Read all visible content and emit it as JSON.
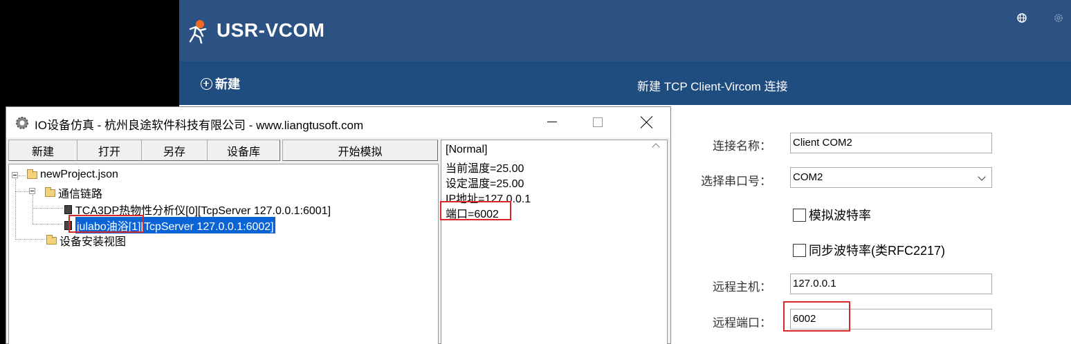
{
  "vcom": {
    "app_title": "USR-VCOM",
    "new_button": "新建",
    "connection_title": "新建 TCP Client-Vircom 连接",
    "form": {
      "name_label": "连接名称：",
      "name_value": "Client COM2",
      "port_label": "选择串口号：",
      "port_value": "COM2",
      "sim_baud_label": "模拟波特率",
      "sync_baud_label": "同步波特率(类RFC2217)",
      "remote_host_label": "远程主机：",
      "remote_host_value": "127.0.0.1",
      "remote_port_label": "远程端口：",
      "remote_port_value": "6002"
    },
    "colors": {
      "header": "#2b5283",
      "toolbar": "#204d80"
    }
  },
  "io": {
    "window_title": "IO设备仿真 - 杭州良途软件科技有限公司 - www.liangtusoft.com",
    "toolbar": {
      "new": "新建",
      "open": "打开",
      "save_as": "另存",
      "device_lib": "设备库",
      "start_sim": "开始模拟"
    },
    "tree": {
      "root": "newProject.json",
      "comm_link": "通信链路",
      "device1": "TCA3DP热物性分析仪[0][TcpServer 127.0.0.1:6001]",
      "device2_name": "julabo油浴[",
      "device2_rest": "1][TcpServer 127.0.0.1:6002]",
      "install_view": "设备安装视图"
    },
    "detail": {
      "status": "[Normal]",
      "current_temp": "当前温度=25.00",
      "set_temp": "设定温度=25.00",
      "ip": "IP地址=127.0.0.1",
      "port": "端口=6002"
    }
  },
  "highlight_color": "#d9262b"
}
